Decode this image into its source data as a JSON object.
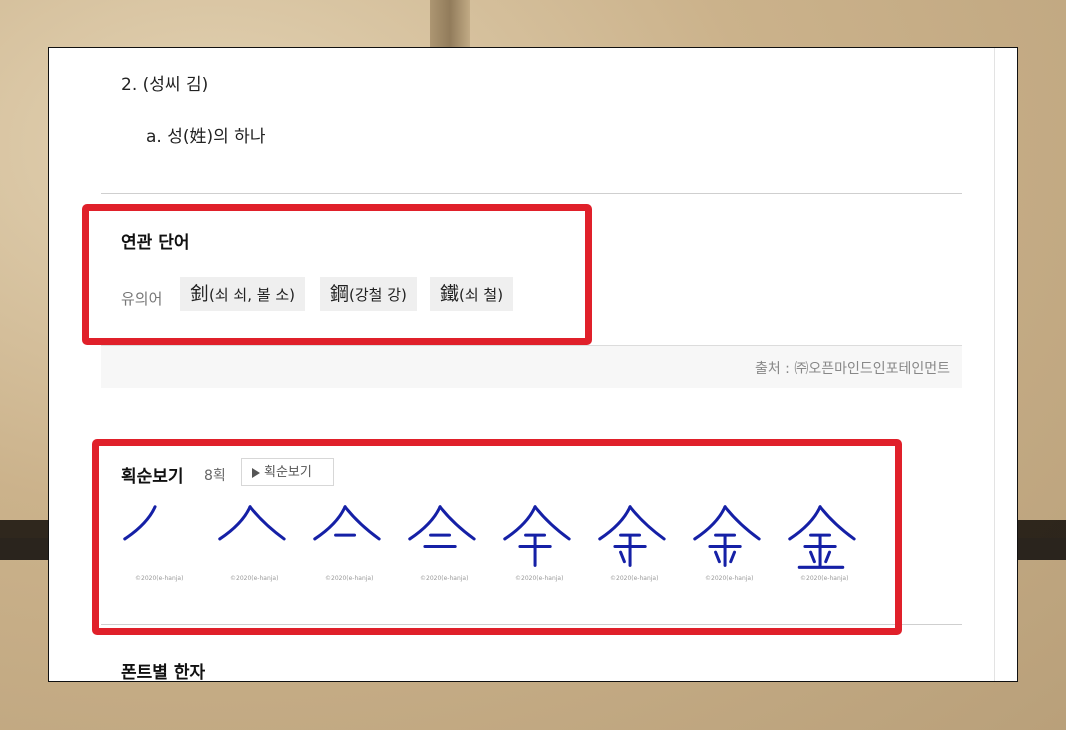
{
  "definition": {
    "item_2": "2.  (성씨 김)",
    "item_2a": "a.  성(姓)의 하나"
  },
  "related": {
    "title": "연관 단어",
    "synonym_label": "유의어",
    "chips": [
      {
        "hanja": "釗",
        "reading": "(쇠 쇠, 볼 소)"
      },
      {
        "hanja": "鋼",
        "reading": "(강철 강)"
      },
      {
        "hanja": "鐵",
        "reading": "(쇠 철)"
      }
    ],
    "source": "출처 : ㈜오픈마인드인포테인먼트"
  },
  "stroke_order": {
    "title": "획순보기",
    "count": "8획",
    "button_label": "획순보기",
    "caption": "©2020(e-hanja)",
    "steps": 8,
    "color": "#1520a6"
  },
  "fonts": {
    "title": "폰트별 한자"
  },
  "colors": {
    "highlight": "#e0202a",
    "stroke": "#1520a6"
  }
}
